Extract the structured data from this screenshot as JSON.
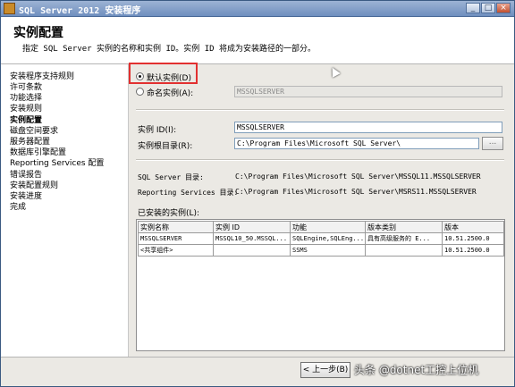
{
  "window": {
    "title": "SQL Server 2012 安装程序",
    "controls": [
      "_",
      "□",
      "×"
    ]
  },
  "header": {
    "title": "实例配置",
    "description": "指定 SQL Server 实例的名称和实例 ID。实例 ID 将成为安装路径的一部分。"
  },
  "sidebar": {
    "items": [
      {
        "label": "安装程序支持规则"
      },
      {
        "label": "许可条款"
      },
      {
        "label": "功能选择"
      },
      {
        "label": "安装规则"
      },
      {
        "label": "实例配置",
        "active": true
      },
      {
        "label": "磁盘空间要求"
      },
      {
        "label": "服务器配置"
      },
      {
        "label": "数据库引擎配置"
      },
      {
        "label": "Reporting Services 配置"
      },
      {
        "label": "错误报告"
      },
      {
        "label": "安装配置规则"
      },
      {
        "label": "安装进度"
      },
      {
        "label": "完成"
      }
    ]
  },
  "instance": {
    "default_label": "默认实例(D)",
    "named_label": "命名实例(A):",
    "named_value": "MSSQLSERVER",
    "id_label": "实例 ID(I):",
    "id_value": "MSSQLSERVER",
    "root_label": "实例根目录(R):",
    "root_value": "C:\\Program Files\\Microsoft SQL Server\\",
    "browse_label": "..."
  },
  "dirs": {
    "sql_label": "SQL Server 目录:",
    "sql_value": "C:\\Program Files\\Microsoft SQL Server\\MSSQL11.MSSQLSERVER",
    "rs_label": "Reporting Services 目录:",
    "rs_value": "C:\\Program Files\\Microsoft SQL Server\\MSRS11.MSSQLSERVER"
  },
  "installed": {
    "label": "已安装的实例(L):",
    "columns": [
      "实例名称",
      "实例 ID",
      "功能",
      "版本类别",
      "版本"
    ],
    "rows": [
      [
        "MSSQLSERVER",
        "MSSQL10_50.MSSQL...",
        "SQLEngine,SQLEng...",
        "具有高级服务的 E...",
        "10.51.2500.0"
      ],
      [
        "<共享组件>",
        "",
        "SSMS",
        "",
        "10.51.2500.0"
      ]
    ]
  },
  "footer": {
    "back_label": "< 上一步(B)",
    "watermark": "头条 @dotnet工控上位机"
  }
}
